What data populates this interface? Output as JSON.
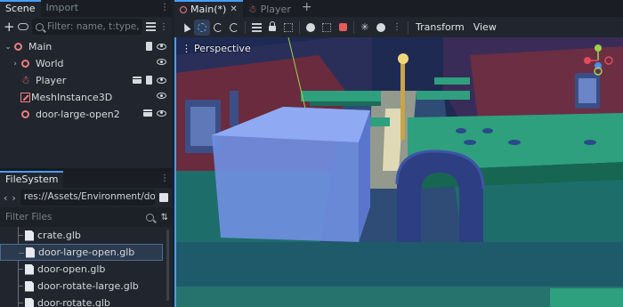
{
  "scene_dock": {
    "tabs": [
      "Scene",
      "Import"
    ],
    "filter_placeholder": "Filter: name, t:type, g:gro",
    "nodes": [
      {
        "label": "Main",
        "type": "node3d"
      },
      {
        "label": "World",
        "type": "node3d"
      },
      {
        "label": "Player",
        "type": "player"
      },
      {
        "label": "MeshInstance3D",
        "type": "mesh"
      },
      {
        "label": "door-large-open2",
        "type": "node3d"
      }
    ]
  },
  "filesystem_dock": {
    "tab": "FileSystem",
    "path": "res://Assets/Environment/doo",
    "filter_placeholder": "Filter Files",
    "files": [
      {
        "label": "crate.glb",
        "selected": false
      },
      {
        "label": "door-large-open.glb",
        "selected": true
      },
      {
        "label": "door-open.glb",
        "selected": false
      },
      {
        "label": "door-rotate-large.glb",
        "selected": false
      },
      {
        "label": "door-rotate.glb",
        "selected": false
      }
    ]
  },
  "editor_tabs": {
    "items": [
      {
        "label": "Main(*)",
        "active": true,
        "close": "✕"
      },
      {
        "label": "Player",
        "active": false
      }
    ],
    "add": "+"
  },
  "viewport_toolbar": {
    "menus": [
      "Transform",
      "View"
    ]
  },
  "viewport": {
    "mode_label": "Perspective",
    "menu_glyph": "⋮"
  },
  "colors": {
    "accent": "#4a9df8",
    "node_icon": "#f07c7c",
    "selection": "#2b3a4d"
  }
}
